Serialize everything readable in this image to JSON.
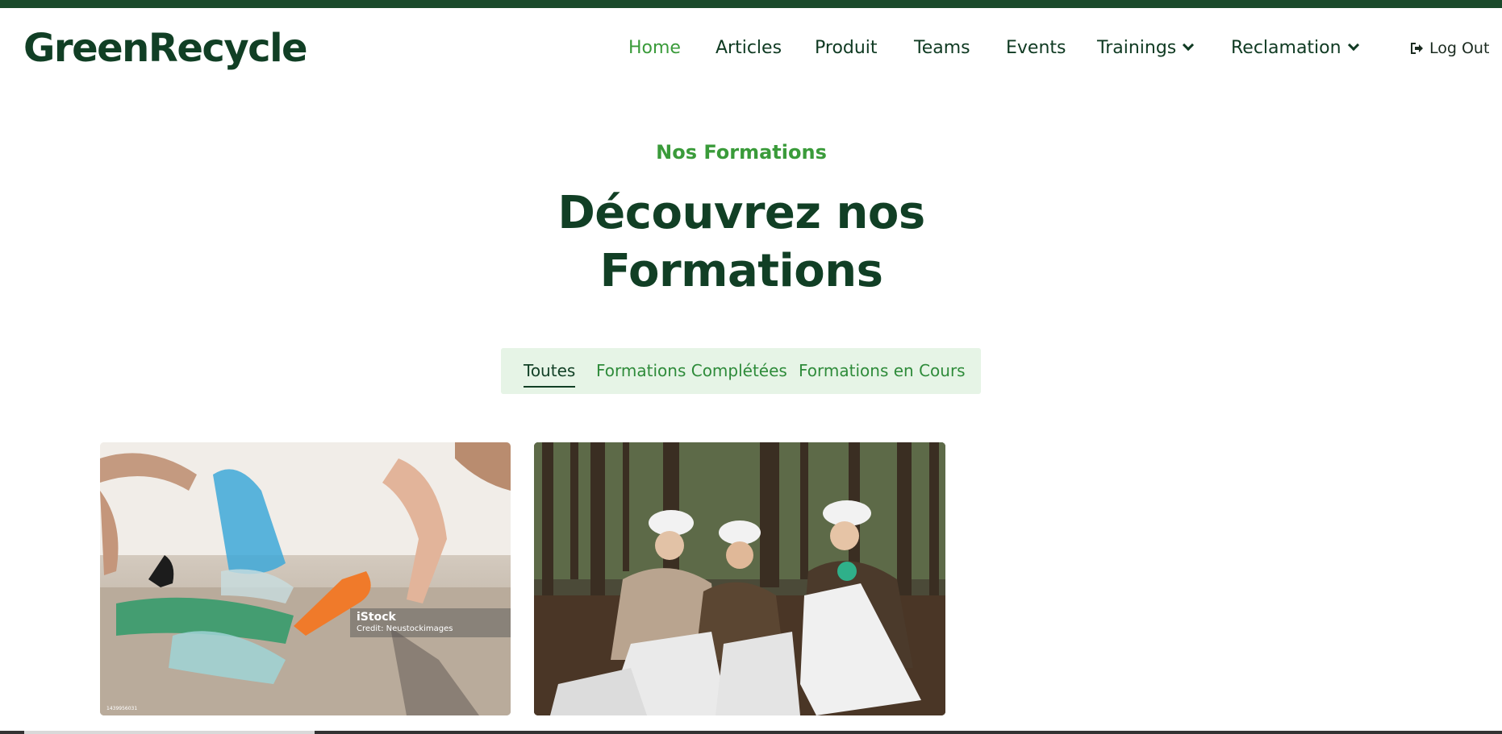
{
  "brand": {
    "name": "GreenRecycle"
  },
  "nav": {
    "items": [
      {
        "label": "Home",
        "active": true,
        "dropdown": false
      },
      {
        "label": "Articles",
        "active": false,
        "dropdown": false
      },
      {
        "label": "Produit",
        "active": false,
        "dropdown": false
      },
      {
        "label": "Teams",
        "active": false,
        "dropdown": false
      },
      {
        "label": "Events",
        "active": false,
        "dropdown": false
      },
      {
        "label": "Trainings",
        "active": false,
        "dropdown": true
      },
      {
        "label": "Reclamation",
        "active": false,
        "dropdown": true
      }
    ],
    "logout_label": "Log Out",
    "logout_icon": "sign-out-icon"
  },
  "hero": {
    "eyebrow": "Nos Formations",
    "title_line1": "Découvrez nos",
    "title_line2": "Formations"
  },
  "tabs": {
    "items": [
      {
        "label": "Toutes",
        "active": true
      },
      {
        "label": "Formations Complétées",
        "active": false
      },
      {
        "label": "Formations en Cours",
        "active": false
      }
    ]
  },
  "cards": [
    {
      "image": "beach-plastic-cleanup-photo",
      "watermark": "iStock",
      "credit": "Credit: Neustockimages",
      "code": "1439956031"
    },
    {
      "image": "forest-cleanup-volunteers-photo"
    }
  ],
  "colors": {
    "accent": "#3a9b3a",
    "brand_dark": "#113f25",
    "tab_bg": "#e6f4e6",
    "top_bar": "#1a4a2b"
  }
}
